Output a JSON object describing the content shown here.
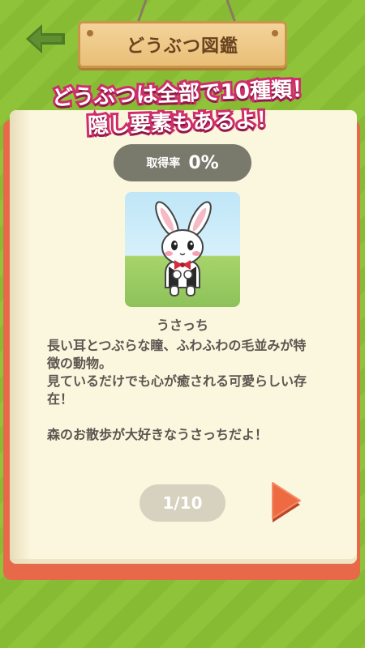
{
  "header": {
    "title": "どうぶつ図鑑",
    "back_icon": "arrow-left-icon"
  },
  "banner": {
    "line1": "どうぶつは全部で10種類！",
    "line2": "隠し要素もあるよ！"
  },
  "collection": {
    "rate_label": "取得率",
    "rate_value": "0%"
  },
  "animal": {
    "image": "rabbit-character",
    "name": "うさっち",
    "description": "長い耳とつぶらな瞳、ふわふわの毛並みが特徴の動物。\n見ているだけでも心が癒される可愛らしい存在！\n\n森のお散歩が大好きなうさっちだよ！"
  },
  "pager": {
    "page_text": "1/10",
    "next_icon": "triangle-right-icon"
  },
  "colors": {
    "background": "#8fc43a",
    "page": "#fbf6de",
    "book_cover": "#e8694a",
    "banner_stroke": "#cf2e6b",
    "next_arrow": "#ee6a43"
  }
}
